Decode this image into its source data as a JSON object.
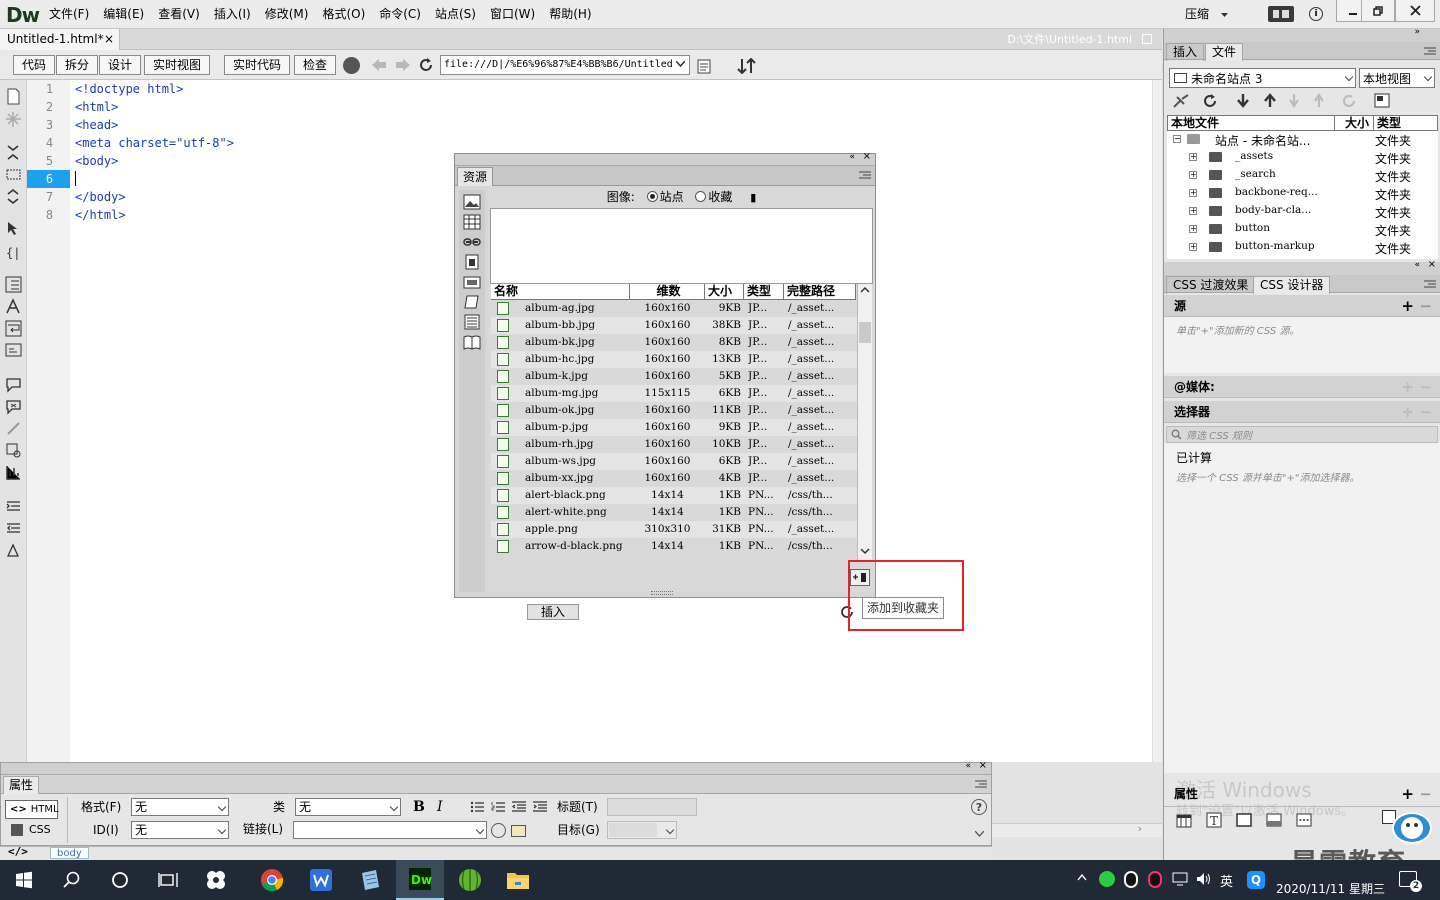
{
  "app": {
    "logo": "Dw",
    "workspace": "压缩"
  },
  "menu": [
    "文件(F)",
    "编辑(E)",
    "查看(V)",
    "插入(I)",
    "修改(M)",
    "格式(O)",
    "命令(C)",
    "站点(S)",
    "窗口(W)",
    "帮助(H)"
  ],
  "document": {
    "tab_label": "Untitled-1.html*",
    "path": "D:\\文件\\Untitled-1.html"
  },
  "doc_toolbar": {
    "view_buttons": [
      "代码",
      "拆分",
      "设计",
      "实时视图"
    ],
    "live_code": "实时代码",
    "inspect": "检查",
    "address": "file:///D|/%E6%96%87%E4%BB%B6/Untitled"
  },
  "code": {
    "line_numbers": [
      "1",
      "2",
      "3",
      "4",
      "5",
      "6",
      "7",
      "8"
    ],
    "active_line": "6",
    "lines": [
      "<!doctype html>",
      "<html>",
      "<head>",
      "<meta charset=\"utf-8\">",
      "<body>",
      "",
      "</body>",
      "</html>"
    ]
  },
  "assets": {
    "tab": "资源",
    "filter_label": "图像:",
    "site_option": "站点",
    "favorites_option": "收藏",
    "columns": [
      "名称",
      "维数",
      "大小",
      "类型",
      "完整路径"
    ],
    "rows": [
      {
        "name": "album-ag.jpg",
        "dim": "160x160",
        "size": "9KB",
        "type": "JP...",
        "path": "/_asset..."
      },
      {
        "name": "album-bb.jpg",
        "dim": "160x160",
        "size": "38KB",
        "type": "JP...",
        "path": "/_asset..."
      },
      {
        "name": "album-bk.jpg",
        "dim": "160x160",
        "size": "8KB",
        "type": "JP...",
        "path": "/_asset..."
      },
      {
        "name": "album-hc.jpg",
        "dim": "160x160",
        "size": "13KB",
        "type": "JP...",
        "path": "/_asset..."
      },
      {
        "name": "album-k.jpg",
        "dim": "160x160",
        "size": "5KB",
        "type": "JP...",
        "path": "/_asset..."
      },
      {
        "name": "album-mg.jpg",
        "dim": "115x115",
        "size": "6KB",
        "type": "JP...",
        "path": "/_asset..."
      },
      {
        "name": "album-ok.jpg",
        "dim": "160x160",
        "size": "11KB",
        "type": "JP...",
        "path": "/_asset..."
      },
      {
        "name": "album-p.jpg",
        "dim": "160x160",
        "size": "9KB",
        "type": "JP...",
        "path": "/_asset..."
      },
      {
        "name": "album-rh.jpg",
        "dim": "160x160",
        "size": "10KB",
        "type": "JP...",
        "path": "/_asset..."
      },
      {
        "name": "album-ws.jpg",
        "dim": "160x160",
        "size": "6KB",
        "type": "JP...",
        "path": "/_asset..."
      },
      {
        "name": "album-xx.jpg",
        "dim": "160x160",
        "size": "4KB",
        "type": "JP...",
        "path": "/_asset..."
      },
      {
        "name": "alert-black.png",
        "dim": "14x14",
        "size": "1KB",
        "type": "PN...",
        "path": "/css/th..."
      },
      {
        "name": "alert-white.png",
        "dim": "14x14",
        "size": "1KB",
        "type": "PN...",
        "path": "/css/th..."
      },
      {
        "name": "apple.png",
        "dim": "310x310",
        "size": "31KB",
        "type": "PN...",
        "path": "/_asset..."
      },
      {
        "name": "arrow-d-black.png",
        "dim": "14x14",
        "size": "1KB",
        "type": "PN...",
        "path": "/css/th..."
      }
    ],
    "insert_label": "插入",
    "tooltip": "添加到收藏夹"
  },
  "properties": {
    "title": "属性",
    "html_btn": "HTML",
    "css_btn": "CSS",
    "format_label": "格式(F)",
    "format_value": "无",
    "id_label": "ID(I)",
    "id_value": "无",
    "class_label": "类",
    "class_value": "无",
    "link_label": "链接(L)",
    "title_label": "标题(T)",
    "target_label": "目标(G)"
  },
  "status": {
    "tag": "body"
  },
  "right": {
    "tabs": [
      "插入",
      "文件"
    ],
    "site_select": "未命名站点 3",
    "view_select": "本地视图",
    "file_cols": [
      "本地文件",
      "大小",
      "类型"
    ],
    "tree": [
      {
        "name": "站点 - 未命名站...",
        "type": "文件夹"
      },
      {
        "name": "_assets",
        "type": "文件夹"
      },
      {
        "name": "_search",
        "type": "文件夹"
      },
      {
        "name": "backbone-req...",
        "type": "文件夹"
      },
      {
        "name": "body-bar-cla...",
        "type": "文件夹"
      },
      {
        "name": "button",
        "type": "文件夹"
      },
      {
        "name": "button-markup",
        "type": "文件夹"
      }
    ],
    "css_tabs": [
      "CSS 过渡效果",
      "CSS 设计器"
    ],
    "source": "源",
    "source_hint": "单击\"+\"添加新的 CSS 源。",
    "media": "@媒体:",
    "selector": "选择器",
    "filter_placeholder": "筛选 CSS 规则",
    "computed": "已计算",
    "selector_hint": "选择一个 CSS 源并单击\"+\"添加选择器。",
    "props_section": "属性",
    "watermark1": "激活 Windows",
    "watermark2": "转到\"设置\"以激活 Windows。",
    "brand": "最需教育"
  },
  "taskbar": {
    "ime": "英",
    "date": "2020/11/11 星期三",
    "notif": "2"
  }
}
